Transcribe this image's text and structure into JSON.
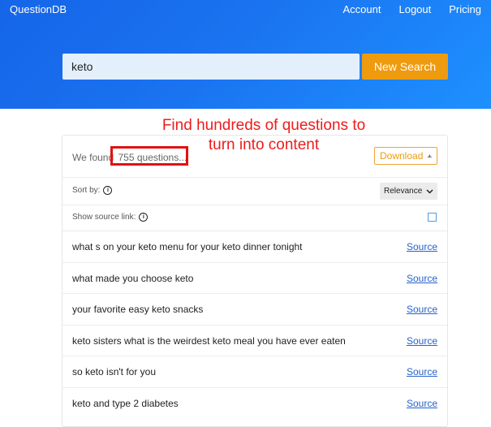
{
  "header": {
    "brand": "QuestionDB",
    "nav": [
      "Account",
      "Logout",
      "Pricing"
    ]
  },
  "search": {
    "value": "keto",
    "button_label": "New Search"
  },
  "annotation": {
    "line1": "Find hundreds of questions to",
    "line2": "turn into content"
  },
  "results": {
    "found_prefix": "We found",
    "found_count": "755 questions...",
    "download_label": "Download",
    "sort_label": "Sort by:",
    "sort_value": "Relevance",
    "source_link_label": "Show source link:",
    "source_text": "Source",
    "questions": [
      "what s on your keto menu for your keto dinner tonight",
      "what made you choose keto",
      "your favorite easy keto snacks",
      "keto sisters what is the weirdest keto meal you have ever eaten",
      "so keto isn't for you",
      "keto and type 2 diabetes"
    ]
  },
  "colors": {
    "hero": "#1a73f0",
    "accent": "#ef9b0f",
    "annotation": "#ee1c1c",
    "link": "#2563c9"
  }
}
